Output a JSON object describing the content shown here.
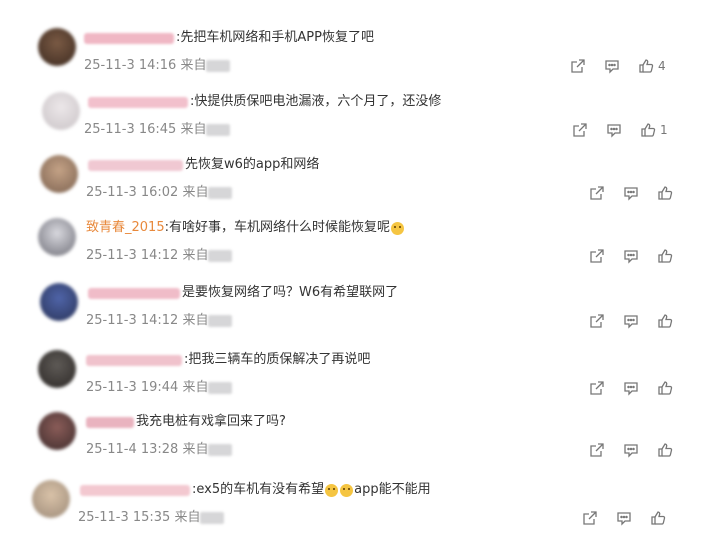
{
  "comments": [
    {
      "prefix": "",
      "text": ":先把车机网络和手机APP恢复了吧",
      "time": "25-11-3 14:16",
      "source": "来自",
      "likes": "4",
      "emoji": ""
    },
    {
      "prefix": "",
      "text": ":快提供质保吧电池漏液，六个月了，还没修",
      "time": "25-11-3 16:45",
      "source": "来自",
      "likes": "1",
      "emoji": ""
    },
    {
      "prefix": "",
      "text": "先恢复w6的app和网络",
      "time": "25-11-3 16:02",
      "source": "来自",
      "likes": "",
      "emoji": ""
    },
    {
      "prefix": "致青春_2015",
      "text": ":有啥好事，车机网络什么时候能恢复呢",
      "time": "25-11-3 14:12",
      "source": "来自",
      "likes": "",
      "emoji": "thinking-emoji"
    },
    {
      "prefix": "",
      "text": "是要恢复网络了吗？W6有希望联网了",
      "time": "25-11-3 14:12",
      "source": "来自",
      "likes": "",
      "emoji": ""
    },
    {
      "prefix": "",
      "text": ":把我三辆车的质保解决了再说吧",
      "time": "25-11-3 19:44",
      "source": "来自",
      "likes": "",
      "emoji": ""
    },
    {
      "prefix": "",
      "text": "我充电桩有戏拿回来了吗?",
      "time": "25-11-4 13:28",
      "source": "来自",
      "likes": "",
      "emoji": ""
    },
    {
      "prefix": "",
      "text": ":ex5的车机有没有希望",
      "text2": "app能不能用",
      "time": "25-11-3 15:35",
      "source": "来自",
      "likes": "",
      "emoji": "crying-emoji"
    }
  ],
  "colors": {
    "username_link": "#e8893c",
    "meta": "#888888",
    "icon": "#777777"
  }
}
